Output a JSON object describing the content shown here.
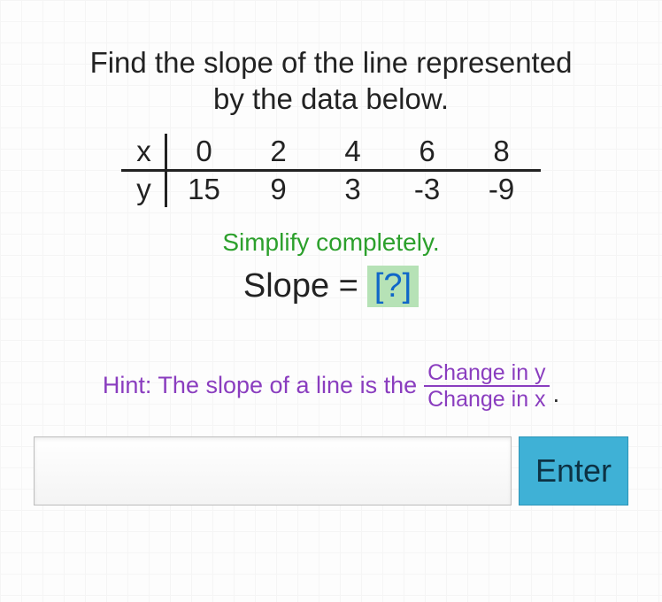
{
  "question": {
    "line1": "Find the slope of the line represented",
    "line2": "by the data below."
  },
  "table": {
    "row_labels": [
      "x",
      "y"
    ],
    "x": [
      "0",
      "2",
      "4",
      "6",
      "8"
    ],
    "y": [
      "15",
      "9",
      "3",
      "-3",
      "-9"
    ]
  },
  "simplify_text": "Simplify completely.",
  "slope_label": "Slope =",
  "answer_placeholder": "[?]",
  "hint": {
    "prefix": "Hint: The slope of a line is the",
    "numerator": "Change in y",
    "denominator": "Change in x"
  },
  "enter_label": "Enter",
  "input_value": ""
}
